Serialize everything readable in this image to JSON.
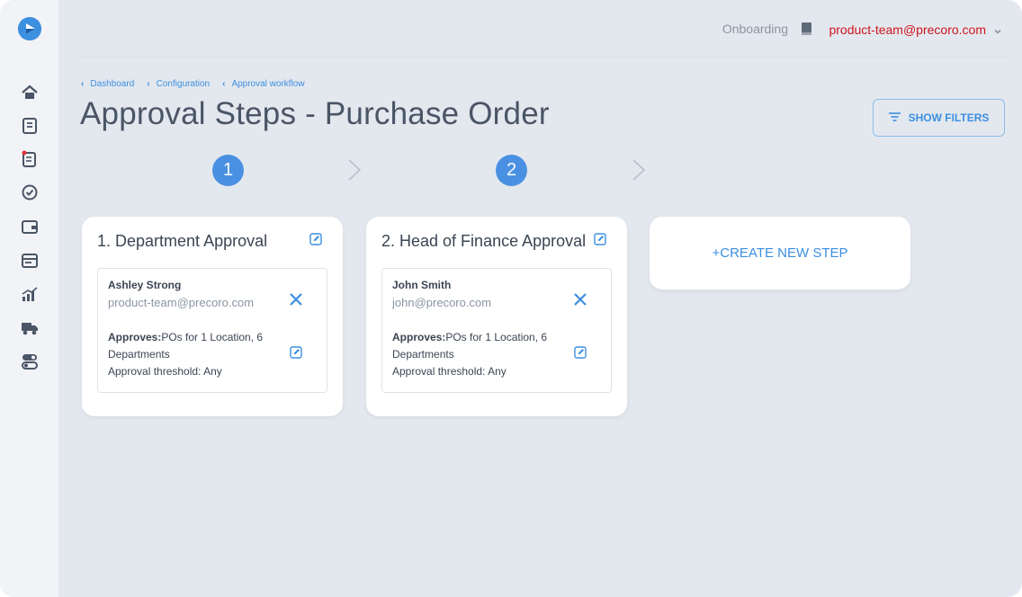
{
  "colors": {
    "accent": "#3d8fe0",
    "step_circle": "#4a90e2",
    "user_email": "#d1141b",
    "title_text": "#4a5566",
    "background": "#e3e8ef",
    "sidebar": "#f1f3f7"
  },
  "sidebar": {
    "logo": "play-logo-icon",
    "items": [
      {
        "icon": "home-icon"
      },
      {
        "icon": "requisition-icon"
      },
      {
        "icon": "purchase-order-icon"
      },
      {
        "icon": "approvals-check-icon"
      },
      {
        "icon": "wallet-icon"
      },
      {
        "icon": "invoice-card-icon"
      },
      {
        "icon": "analytics-icon"
      },
      {
        "icon": "delivery-truck-icon"
      },
      {
        "icon": "settings-toggles-icon"
      }
    ]
  },
  "header": {
    "onboarding_label": "Onboarding",
    "onboarding_icon": "book-icon",
    "user_email": "product-team@precoro.com",
    "user_menu_icon": "chevron-down-icon"
  },
  "breadcrumb": [
    {
      "label": "Dashboard"
    },
    {
      "label": "Configuration"
    },
    {
      "label": "Approval workflow"
    }
  ],
  "page": {
    "title": "Approval Steps - Purchase Order",
    "show_filters_label": "SHOW FILTERS",
    "show_filters_icon": "filter-icon"
  },
  "stepper": [
    {
      "number": "1"
    },
    {
      "number": "2"
    }
  ],
  "steps": [
    {
      "title": "1. Department Approval",
      "approver": {
        "name": "Ashley Strong",
        "email": "product-team@precoro.com",
        "approves_label": "Approves:",
        "approves_value": "POs for 1 Location, 6 Departments",
        "threshold": "Approval threshold: Any"
      }
    },
    {
      "title": "2. Head of Finance Approval",
      "approver": {
        "name": "John Smith",
        "email": "john@precoro.com",
        "approves_label": "Approves:",
        "approves_value": "POs for 1 Location, 6 Departments",
        "threshold": "Approval threshold: Any"
      }
    }
  ],
  "create_step_label": "+CREATE NEW STEP"
}
